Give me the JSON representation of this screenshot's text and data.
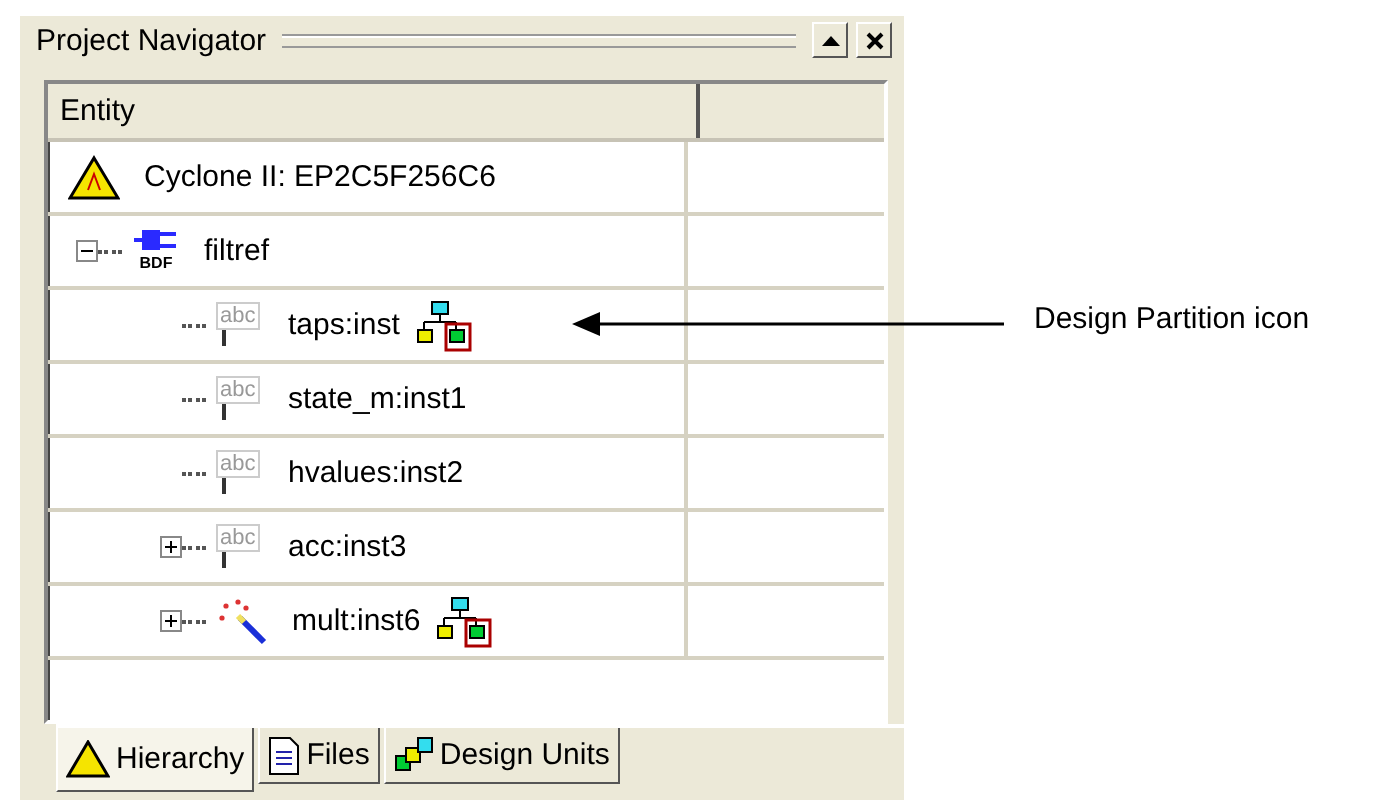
{
  "panel": {
    "title": "Project Navigator"
  },
  "table": {
    "columns": [
      "Entity"
    ]
  },
  "tree": [
    {
      "label": "Cyclone II: EP2C5F256C6",
      "kind": "device",
      "partition": false,
      "children": [
        {
          "label": "filtref",
          "kind": "bdf",
          "icon_text": "BDF",
          "expanded": true,
          "partition": false,
          "children": [
            {
              "label": "taps:inst",
              "kind": "text",
              "icon_text": "abc",
              "partition": true
            },
            {
              "label": "state_m:inst1",
              "kind": "text",
              "icon_text": "abc",
              "partition": false
            },
            {
              "label": "hvalues:inst2",
              "kind": "text",
              "icon_text": "abc",
              "partition": false
            },
            {
              "label": "acc:inst3",
              "kind": "text",
              "icon_text": "abc",
              "expanded": false,
              "partition": false
            },
            {
              "label": "mult:inst6",
              "kind": "wand",
              "expanded": false,
              "partition": true
            }
          ]
        }
      ]
    }
  ],
  "tabs": [
    {
      "label": "Hierarchy",
      "kind": "device",
      "selected": true
    },
    {
      "label": "Files",
      "kind": "files",
      "selected": false
    },
    {
      "label": "Design Units",
      "kind": "units",
      "selected": false
    }
  ],
  "callout": {
    "text": "Design Partition icon"
  }
}
